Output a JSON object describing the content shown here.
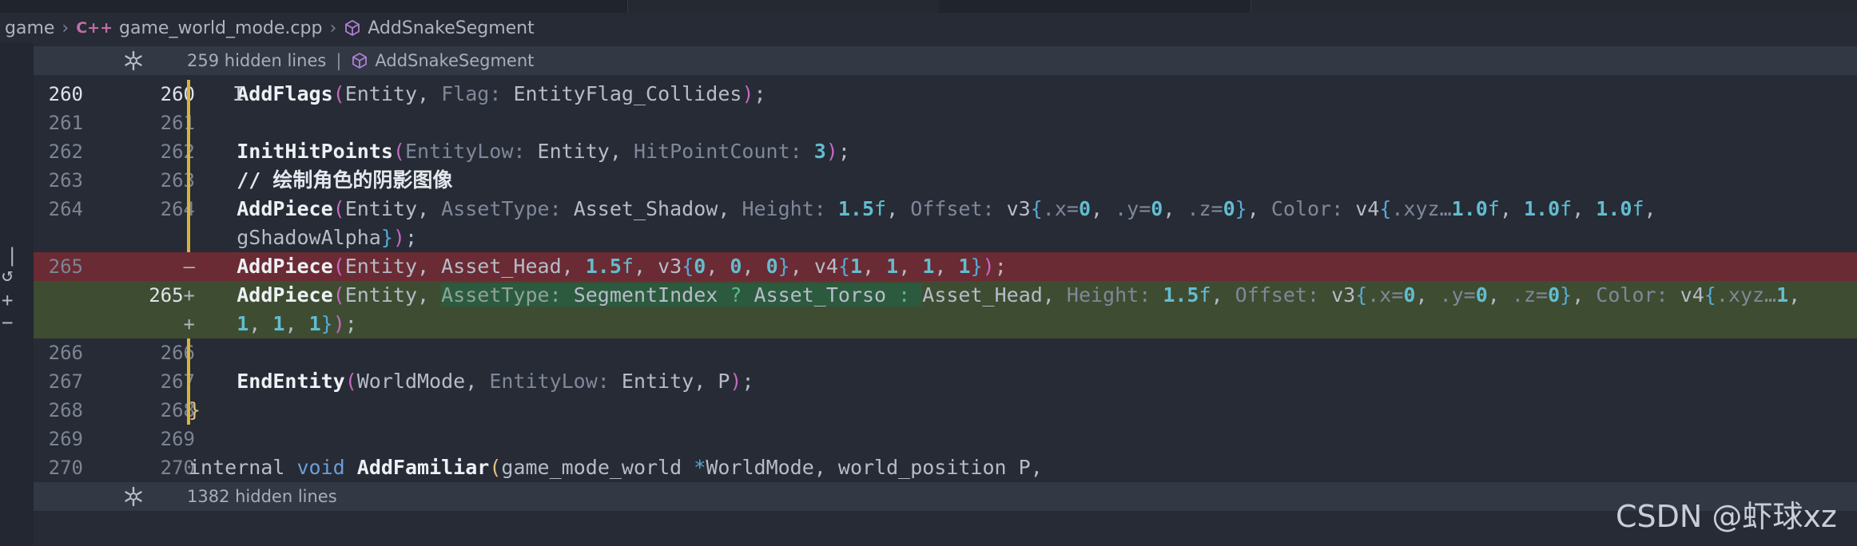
{
  "breadcrumb": {
    "folder": "game",
    "file": "game_world_mode.cpp",
    "symbol": "AddSnakeSegment"
  },
  "folds": {
    "top": {
      "label": "259 hidden lines",
      "symbol": "AddSnakeSegment"
    },
    "bottom": {
      "label": "1382 hidden lines"
    }
  },
  "gutter": {
    "r260_old": "260",
    "r260_new": "260",
    "r261_old": "261",
    "r261_new": "261",
    "r262_old": "262",
    "r262_new": "262",
    "r263_old": "263",
    "r263_new": "263",
    "r264_old": "264",
    "r264_new": "264",
    "del_old": "265",
    "del_mark": "–",
    "add_new": "265",
    "add_mark": "+",
    "add2_mark": "+",
    "r266_old": "266",
    "r266_new": "266",
    "r267_old": "267",
    "r267_new": "267",
    "r268_old": "268",
    "r268_new": "268",
    "r269_old": "269",
    "r269_new": "269",
    "r270_old": "270",
    "r270_new": "270"
  },
  "code": {
    "l260": {
      "fn": "AddFlags",
      "a1": "Entity",
      "h1": "Flag:",
      "a2": "EntityFlag_Collides"
    },
    "l262": {
      "fn": "InitHitPoints",
      "h1": "EntityLow:",
      "a1": "Entity",
      "h2": "HitPointCount:",
      "n1": "3"
    },
    "l263": {
      "comment": "// 绘制角色的阴影图像"
    },
    "l264": {
      "fn": "AddPiece",
      "a1": "Entity",
      "h1": "AssetType:",
      "a2": "Asset_Shadow",
      "h2": "Height:",
      "n1": "1.5",
      "s1": "f",
      "h3": "Offset:",
      "a3": "v3",
      "h4": ".x=",
      "n2": "0",
      "h5": ".y=",
      "n3": "0",
      "h6": ".z=",
      "n4": "0",
      "h7": "Color:",
      "a4": "v4",
      "h8": ".xyz…",
      "n5": "1.0",
      "s5": "f",
      "n6": "1.0",
      "s6": "f",
      "n7": "1.0",
      "s7": "f"
    },
    "l264b": {
      "a1": "gShadowAlpha"
    },
    "del": {
      "fn": "AddPiece",
      "a1": "Entity",
      "a2": "Asset_Head",
      "n1": "1.5",
      "s1": "f",
      "a3": "v3",
      "n2": "0",
      "n3": "0",
      "n4": "0",
      "a4": "v4",
      "n5": "1",
      "n6": "1",
      "n7": "1",
      "n8": "1"
    },
    "add": {
      "fn": "AddPiece",
      "a1": "Entity",
      "h1": "AssetType:",
      "a2": "SegmentIndex",
      "q": "?",
      "a3": "Asset_Torso",
      "c": ":",
      "a4": "Asset_Head",
      "h2": "Height:",
      "n1": "1.5",
      "s1": "f",
      "h3": "Offset:",
      "a5": "v3",
      "h4": ".x=",
      "n2": "0",
      "h5": ".y=",
      "n3": "0",
      "h6": ".z=",
      "n4": "0",
      "h7": "Color:",
      "a6": "v4",
      "h8": ".xyz…",
      "n5": "1"
    },
    "add2": {
      "n1": "1",
      "n2": "1",
      "n3": "1"
    },
    "l267": {
      "fn": "EndEntity",
      "a1": "WorldMode",
      "h1": "EntityLow:",
      "a2": "Entity",
      "a3": "P"
    },
    "l268": {
      "brace": "}"
    },
    "l270": {
      "kw1": "internal",
      "kw2": "void",
      "fn": "AddFamiliar",
      "t1": "game_mode_world",
      "star": "*",
      "a1": "WorldMode",
      "t2": "world_position",
      "a2": "P"
    }
  },
  "watermark": "CSDN @虾球xz"
}
